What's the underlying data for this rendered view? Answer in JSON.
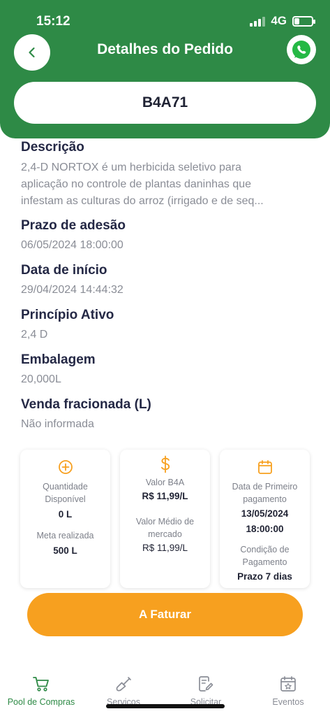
{
  "status_bar": {
    "time": "15:12",
    "network": "4G",
    "battery_level": 0.3
  },
  "header": {
    "title": "Detalhes do Pedido",
    "order_code": "B4A71"
  },
  "details": {
    "description_label": "Descrição",
    "description_lines": [
      "2,4-D NORTOX é um herbicida seletivo para",
      "aplicação no controle de plantas daninhas que",
      "infestam as culturas do arroz (irrigado e de seq..."
    ],
    "deadline_label": "Prazo de adesão",
    "deadline_value": "06/05/2024 18:00:00",
    "start_label": "Data de início",
    "start_value": "29/04/2024 14:44:32",
    "active_label": "Princípio Ativo",
    "active_value": "2,4 D",
    "packaging_label": "Embalagem",
    "packaging_value": "20,000L",
    "fractional_label": "Venda fracionada (L)",
    "fractional_value": "Não informada"
  },
  "cards": {
    "quantity": {
      "icon": "plus-circle-icon",
      "label_1": "Quantidade",
      "label_2": "Disponível",
      "value": "0 L",
      "goal_label": "Meta realizada",
      "goal_value": "500 L"
    },
    "price": {
      "icon": "dollar-icon",
      "label": "Valor B4A",
      "value": "R$ 11,99/L",
      "market_label_1": "Valor Médio de",
      "market_label_2": "mercado",
      "market_value": "R$ 11,99/L"
    },
    "payment": {
      "icon": "calendar-icon",
      "label_1": "Data de Primeiro",
      "label_2": "pagamento",
      "date_1": "13/05/2024",
      "date_2": "18:00:00",
      "cond_label_1": "Condição de",
      "cond_label_2": "Pagamento",
      "cond_value": "Prazo 7 dias"
    }
  },
  "cta": {
    "label": "A Faturar"
  },
  "nav": [
    {
      "label": "Pool de Compras",
      "icon": "cart-icon"
    },
    {
      "label": "Serviços",
      "icon": "shovel-icon"
    },
    {
      "label": "Solicitar",
      "icon": "edit-document-icon"
    },
    {
      "label": "Eventos",
      "icon": "calendar-star-icon"
    }
  ],
  "colors": {
    "primary_green": "#2e8a46",
    "accent_orange": "#f7a01f"
  }
}
